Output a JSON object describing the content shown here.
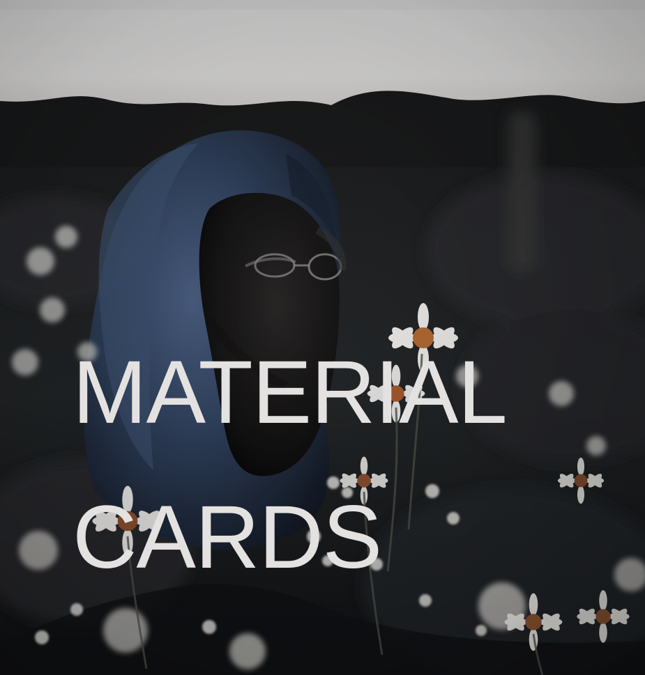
{
  "card": {
    "title_line_1": "MATERIAL",
    "title_line_2": "CARDS"
  },
  "colors": {
    "sky": "#d6d5d4",
    "background_dark": "#1b1d20",
    "hood_blue": "#2a3b57",
    "text": "#e4e2e0",
    "flower_petal": "#f0efee",
    "flower_center": "#b76b36"
  },
  "icons": {
    "main_visual": "portrait-field-image"
  }
}
